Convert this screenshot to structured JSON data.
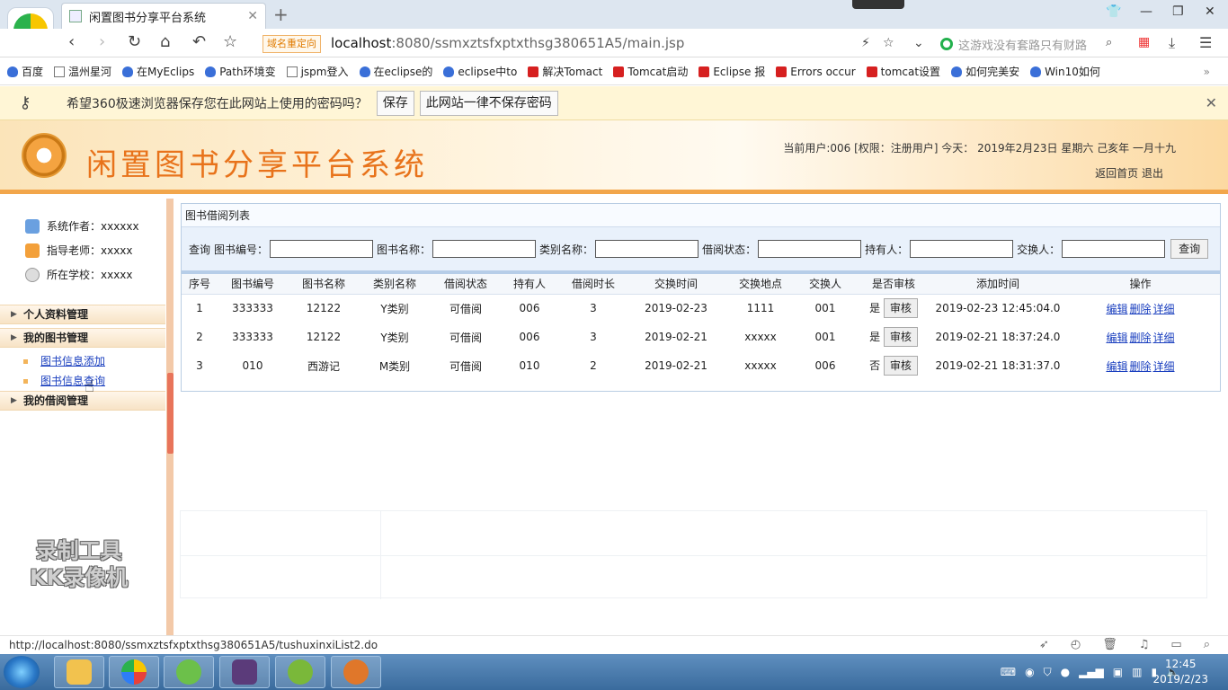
{
  "browser": {
    "tab_title": "闲置图书分享平台系统",
    "redirect_badge": "域名重定向",
    "url_host": "localhost",
    "url_rest": ":8080/ssmxztsfxptxthsg380651A5/main.jsp",
    "search_hint": "这游戏没有套路只有财路",
    "bookmarks": [
      "百度",
      "温州星河",
      "在MyEclips",
      "Path环境变",
      "jspm登入",
      "在eclipse的",
      "eclipse中to",
      "解决Tomact",
      "Tomcat启动",
      "Eclipse 报",
      "Errors occur",
      "tomcat设置",
      "如何完美安",
      "Win10如何"
    ],
    "password_prompt": "希望360极速浏览器保存您在此网站上使用的密码吗？",
    "save_label": "保存",
    "never_save_label": "此网站一律不保存密码"
  },
  "header": {
    "title": "闲置图书分享平台系统",
    "userinfo": "当前用户:006 [权限：注册用户] 今天： 2019年2月23日 星期六 己亥年 一月十九",
    "home_link": "返回首页",
    "logout_link": "退出"
  },
  "sidebar": {
    "author": "系统作者：xxxxxx",
    "teacher": "指导老师：xxxxx",
    "school": "所在学校：xxxxx",
    "sec_profile": "个人资料管理",
    "sec_books": "我的图书管理",
    "link_add": "图书信息添加",
    "link_query": "图书信息查询",
    "sec_borrow": "我的借阅管理"
  },
  "watermark": {
    "line1": "录制工具",
    "line2": "KK录像机"
  },
  "panel": {
    "title": "图书借阅列表",
    "search_prefix": "查询",
    "labels": [
      "图书编号：",
      "图书名称：",
      "类别名称：",
      "借阅状态：",
      "持有人：",
      "交换人："
    ],
    "query_btn": "查询",
    "columns": [
      "序号",
      "图书编号",
      "图书名称",
      "类别名称",
      "借阅状态",
      "持有人",
      "借阅时长",
      "交换时间",
      "交换地点",
      "交换人",
      "是否审核",
      "添加时间",
      "操作"
    ],
    "audit_btn": "审核",
    "op_edit": "编辑",
    "op_delete": "删除",
    "op_detail": "详细",
    "rows": [
      [
        "1",
        "333333",
        "12122",
        "Y类别",
        "可借阅",
        "006",
        "3",
        "2019-02-23",
        "1111",
        "001",
        "是",
        "2019-02-23 12:45:04.0"
      ],
      [
        "2",
        "333333",
        "12122",
        "Y类别",
        "可借阅",
        "006",
        "3",
        "2019-02-21",
        "xxxxx",
        "001",
        "是",
        "2019-02-21 18:37:24.0"
      ],
      [
        "3",
        "010",
        "西游记",
        "M类别",
        "可借阅",
        "010",
        "2",
        "2019-02-21",
        "xxxxx",
        "006",
        "否",
        "2019-02-21 18:31:37.0"
      ]
    ]
  },
  "status": {
    "url": "http://localhost:8080/ssmxztsfxptxthsg380651A5/tushuxinxiList2.do"
  },
  "clock": {
    "time": "12:45",
    "date": "2019/2/23"
  },
  "colors": {
    "accent": "#e8731b",
    "header_border": "#f2a64b",
    "link": "#1a3fbf"
  }
}
